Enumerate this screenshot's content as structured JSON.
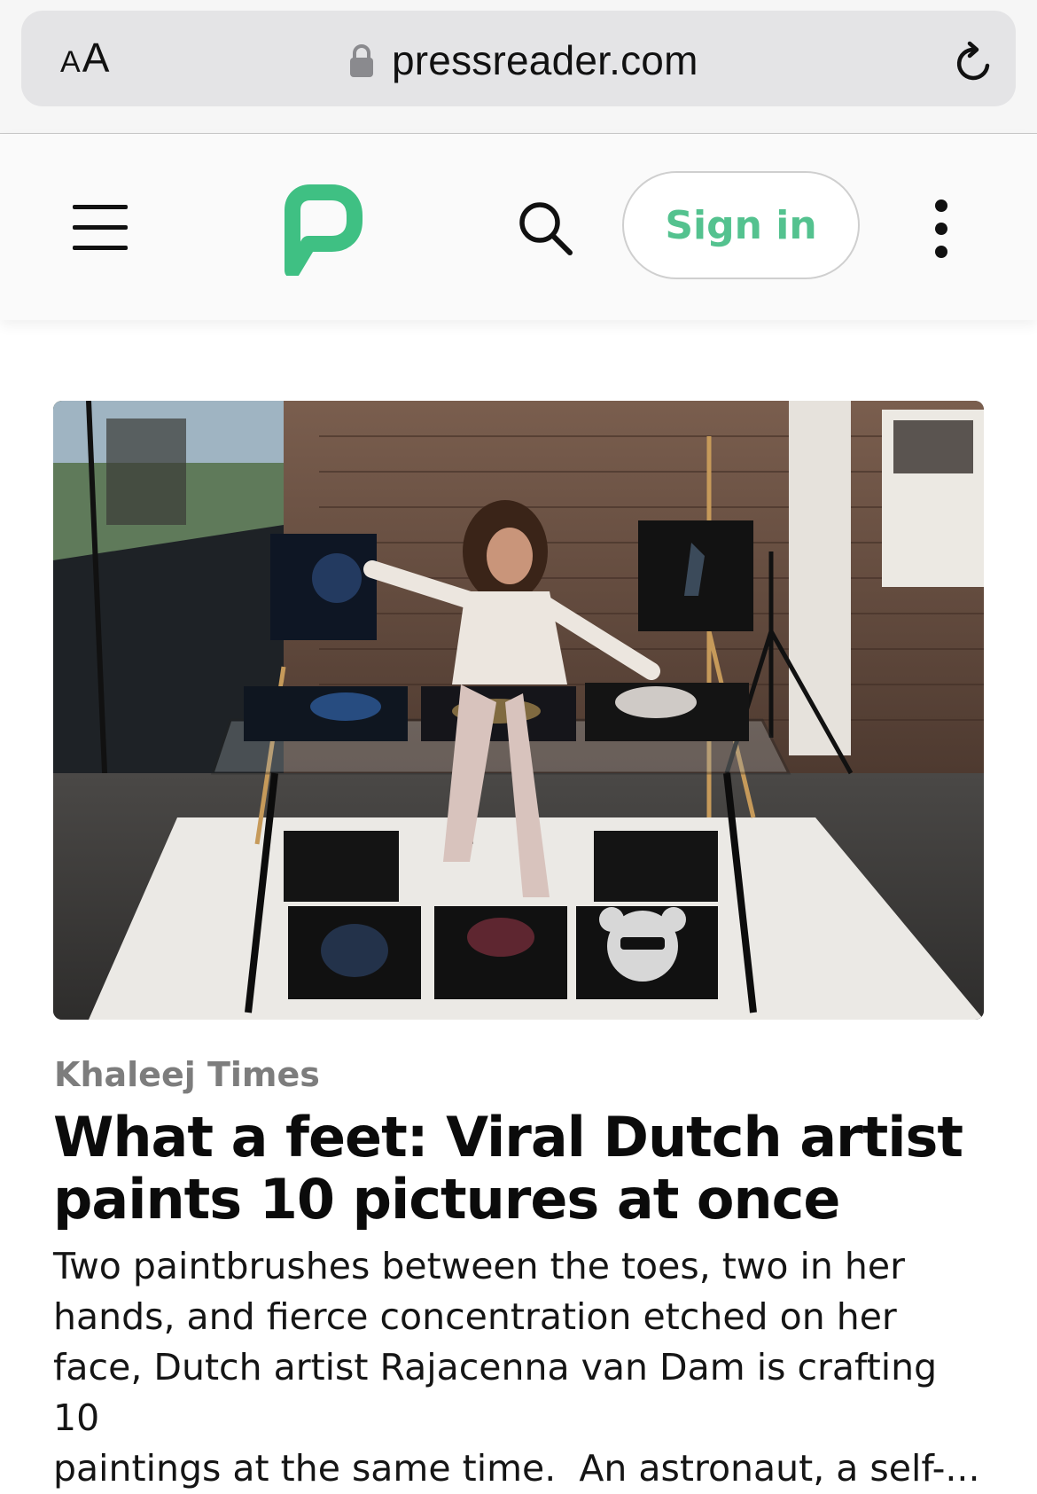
{
  "browser": {
    "text_size_small": "A",
    "text_size_large": "A",
    "url": "pressreader.com"
  },
  "header": {
    "sign_in_label": "Sign in"
  },
  "colors": {
    "brand_green": "#54c28f",
    "logo_green": "#3fc083"
  },
  "icons": {
    "address_bar": [
      "lock-icon",
      "reload-icon"
    ],
    "header": [
      "menu-icon",
      "pressreader-logo",
      "search-icon",
      "more-icon"
    ]
  },
  "article": {
    "source": "Khaleej Times",
    "headline_line1": "What a feet: Viral Dutch artist",
    "headline_line2": "paints 10 pictures at once",
    "excerpt": "Two paintbrushes between the toes, two in her\nhands, and fierce concentration etched on her\nface, Dutch artist Rajacenna van Dam is crafting 10\npaintings at the same time.  An astronaut, a self-..."
  }
}
